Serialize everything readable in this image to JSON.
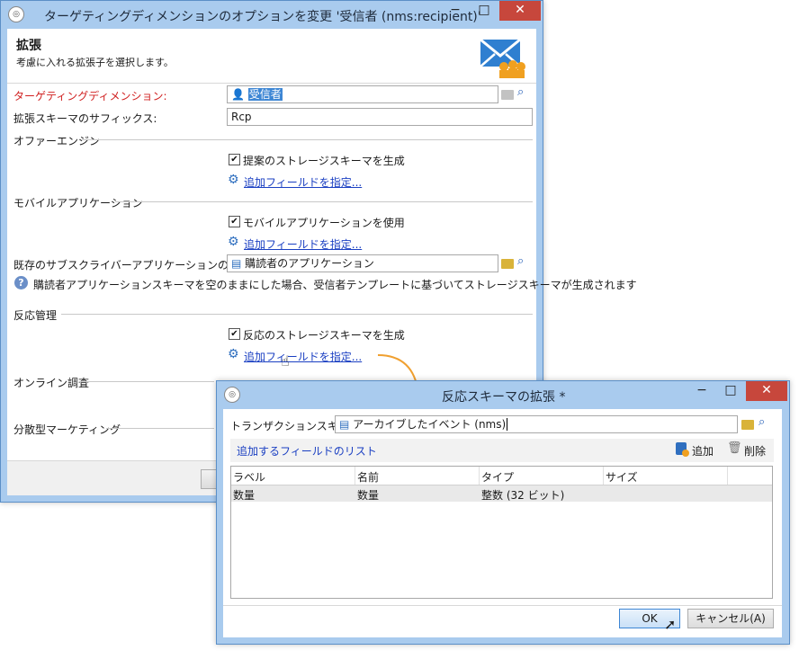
{
  "main_window": {
    "title": "ターゲティングディメンションのオプションを変更 '受信者 (nms:recipient)'",
    "heading": "拡張",
    "subheading": "考慮に入れる拡張子を選択します。",
    "targeting_dimension_label": "ターゲティングディメンション:",
    "targeting_dimension_value": "受信者",
    "suffix_label": "拡張スキーマのサフィックス:",
    "suffix_value": "Rcp",
    "offer_section": "オファーエンジン",
    "offer_checkbox": "提案のストレージスキーマを生成",
    "add_fields_link": "追加フィールドを指定...",
    "mobile_section": "モバイルアプリケーション",
    "mobile_checkbox": "モバイルアプリケーションを使用",
    "subscriber_schema_label": "既存のサブスクライバーアプリケーションのスキーマ:",
    "subscriber_schema_value": "購読者のアプリケーション",
    "info_text": "購読者アプリケーションスキーマを空のままにした場合、受信者テンプレートに基づいてストレージスキーマが生成されます",
    "response_section": "反応管理",
    "response_checkbox": "反応のストレージスキーマを生成",
    "survey_section": "オンライン調査",
    "distributed_section": "分散型マーケティング"
  },
  "dialog": {
    "title": "反応スキーマの拡張 *",
    "transaction_label": "トランザクションスキーマ:",
    "transaction_value": "アーカイブしたイベント (nms)",
    "fields_list_label": "追加するフィールドのリスト",
    "add_label": "追加",
    "delete_label": "削除",
    "columns": [
      "ラベル",
      "名前",
      "タイプ",
      "サイズ"
    ],
    "rows": [
      {
        "label": "数量",
        "name": "数量",
        "type": "整数 (32 ビット)",
        "size": ""
      }
    ],
    "ok_label": "OK",
    "cancel_label": "キャンセル(A)"
  },
  "colors": {
    "frame": "#a9cbee",
    "link": "#1a3fc2",
    "required": "#d02020",
    "close": "#c7473c",
    "arrow": "#f0a030"
  },
  "icons": [
    "app-icon",
    "envelope-icon",
    "user-icon",
    "folder-icon",
    "search-icon",
    "gear-icon",
    "schema-icon",
    "info-icon",
    "cursor-icon",
    "add-icon",
    "trash-icon"
  ]
}
